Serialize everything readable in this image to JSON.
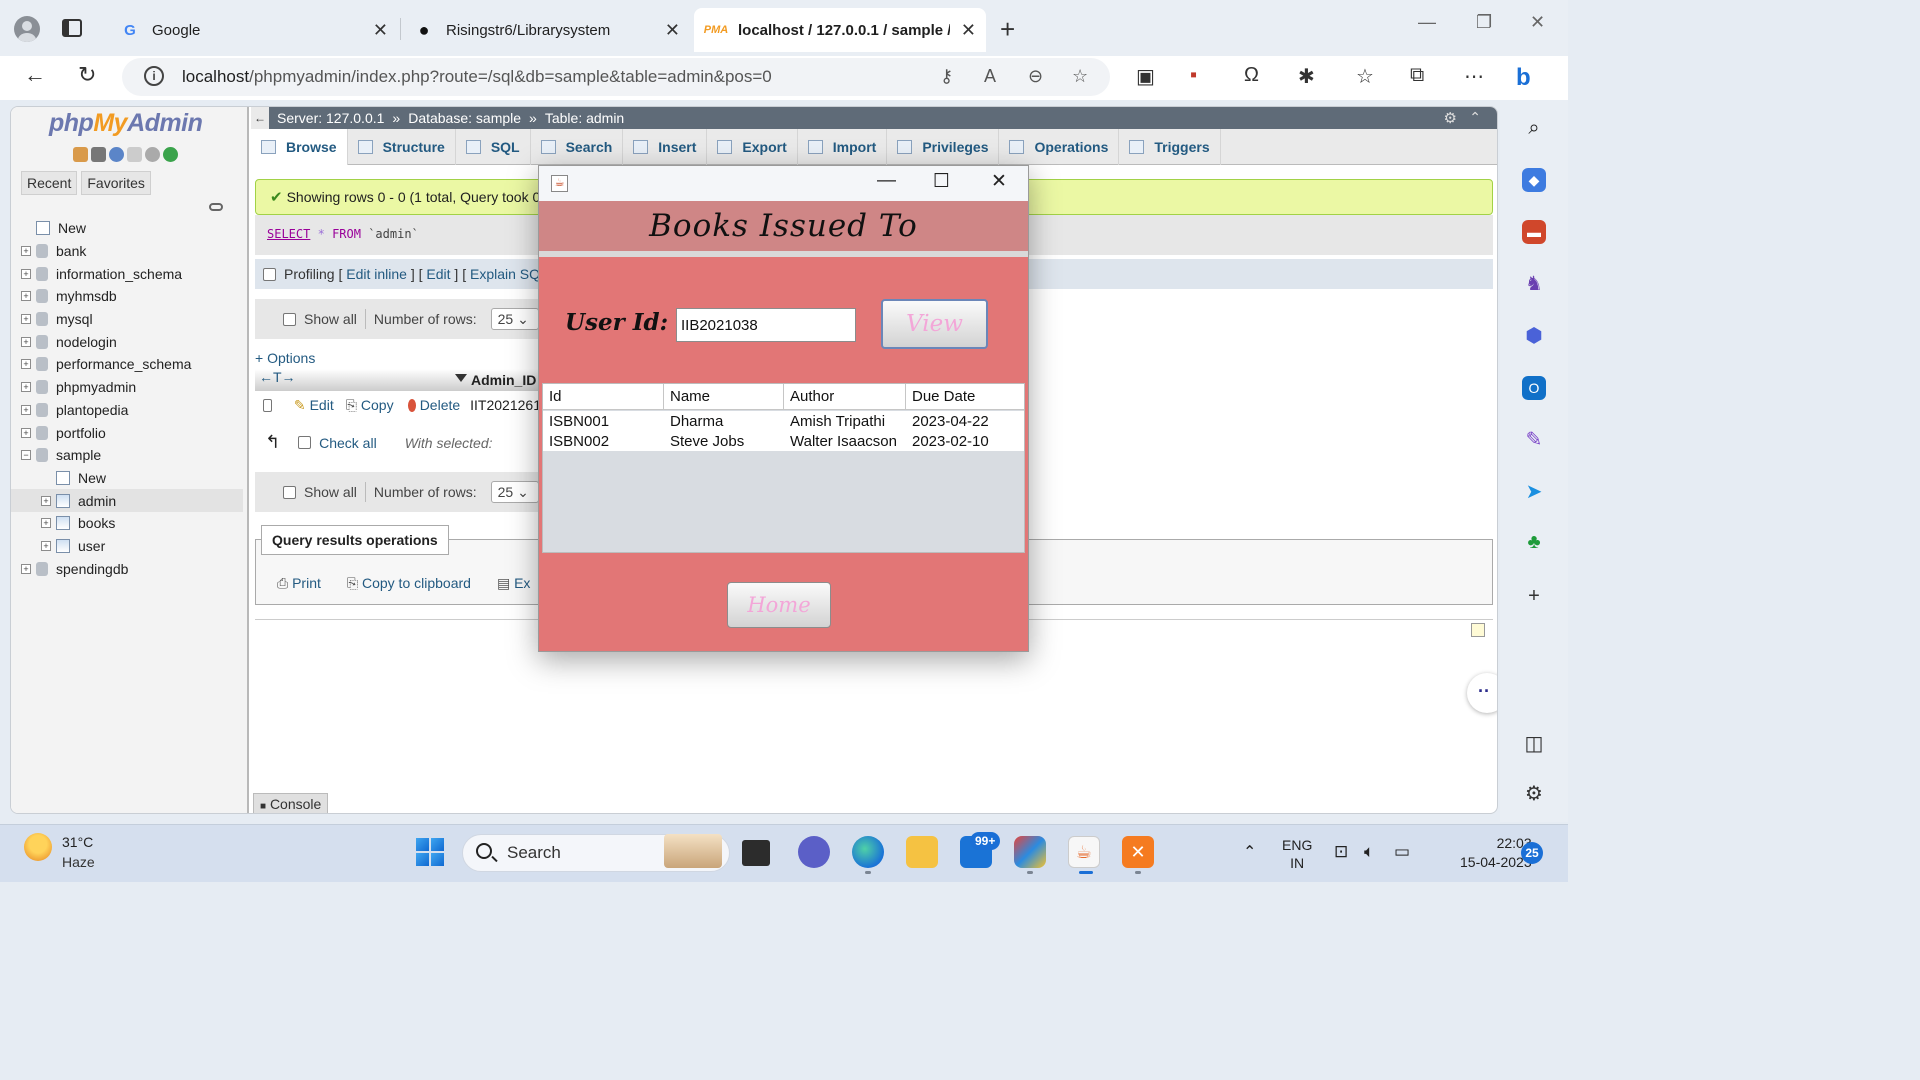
{
  "browser": {
    "tabs": [
      {
        "title": "Google",
        "favicon": "google-icon"
      },
      {
        "title": "Risingstr6/Librarysystem",
        "favicon": "github-icon"
      },
      {
        "title": "localhost / 127.0.0.1 / sample / a",
        "favicon": "phpmyadmin-icon",
        "active": true
      }
    ],
    "url_host": "localhost",
    "url_path": "/phpmyadmin/index.php?route=/sql&db=sample&table=admin&pos=0"
  },
  "pma": {
    "logo_php": "php",
    "logo_my": "My",
    "logo_admin": "Admin",
    "nav_tabs": [
      "Recent",
      "Favorites"
    ],
    "tree": [
      {
        "label": "New",
        "type": "new"
      },
      {
        "label": "bank",
        "type": "db"
      },
      {
        "label": "information_schema",
        "type": "db"
      },
      {
        "label": "myhmsdb",
        "type": "db"
      },
      {
        "label": "mysql",
        "type": "db"
      },
      {
        "label": "nodelogin",
        "type": "db"
      },
      {
        "label": "performance_schema",
        "type": "db"
      },
      {
        "label": "phpmyadmin",
        "type": "db"
      },
      {
        "label": "plantopedia",
        "type": "db"
      },
      {
        "label": "portfolio",
        "type": "db"
      },
      {
        "label": "sample",
        "type": "db",
        "expanded": true
      },
      {
        "label": "New",
        "type": "new-child"
      },
      {
        "label": "admin",
        "type": "table",
        "selected": true
      },
      {
        "label": "books",
        "type": "table"
      },
      {
        "label": "user",
        "type": "table"
      },
      {
        "label": "spendingdb",
        "type": "db"
      }
    ],
    "breadcrumb": {
      "server": "Server: 127.0.0.1",
      "database": "Database: sample",
      "table": "Table: admin"
    },
    "menu_tabs": [
      "Browse",
      "Structure",
      "SQL",
      "Search",
      "Insert",
      "Export",
      "Import",
      "Privileges",
      "Operations",
      "Triggers"
    ],
    "success_message": "Showing rows 0 - 0 (1 total, Query took 0.00",
    "sql": {
      "select": "SELECT",
      "star": "*",
      "from": "FROM",
      "table": "`admin`"
    },
    "profiling": {
      "label": "Profiling",
      "edit_inline": "Edit inline",
      "edit": "Edit",
      "explain": "Explain SQL"
    },
    "show_all": "Show all",
    "number_of_rows_label": "Number of rows:",
    "rows_value": "25",
    "options_link": "+ Options",
    "column_header": "Admin_ID",
    "row": {
      "edit": "Edit",
      "copy": "Copy",
      "delete": "Delete",
      "value": "IIT2021261"
    },
    "check_all": "Check all",
    "with_selected": "With selected:",
    "query_results_operations": "Query results operations",
    "qro_links": [
      "Print",
      "Copy to clipboard",
      "Ex"
    ],
    "console": "Console"
  },
  "dialog": {
    "title": "Books Issued To",
    "user_id_label": "User Id:",
    "user_id_value": "IIB2021038",
    "view_button": "View",
    "home_button": "Home",
    "columns": [
      "Id",
      "Name",
      "Author",
      "Due Date"
    ],
    "rows": [
      [
        "ISBN001",
        "Dharma",
        "Amish Tripathi",
        "2023-04-22"
      ],
      [
        "ISBN002",
        "Steve Jobs",
        "Walter Isaacson",
        "2023-02-10"
      ]
    ]
  },
  "taskbar": {
    "temperature": "31°C",
    "weather": "Haze",
    "search_placeholder": "Search",
    "mail_badge": "99+",
    "lang_top": "ENG",
    "lang_bottom": "IN",
    "time": "22:03",
    "date": "15-04-2023",
    "notifications": "25"
  }
}
